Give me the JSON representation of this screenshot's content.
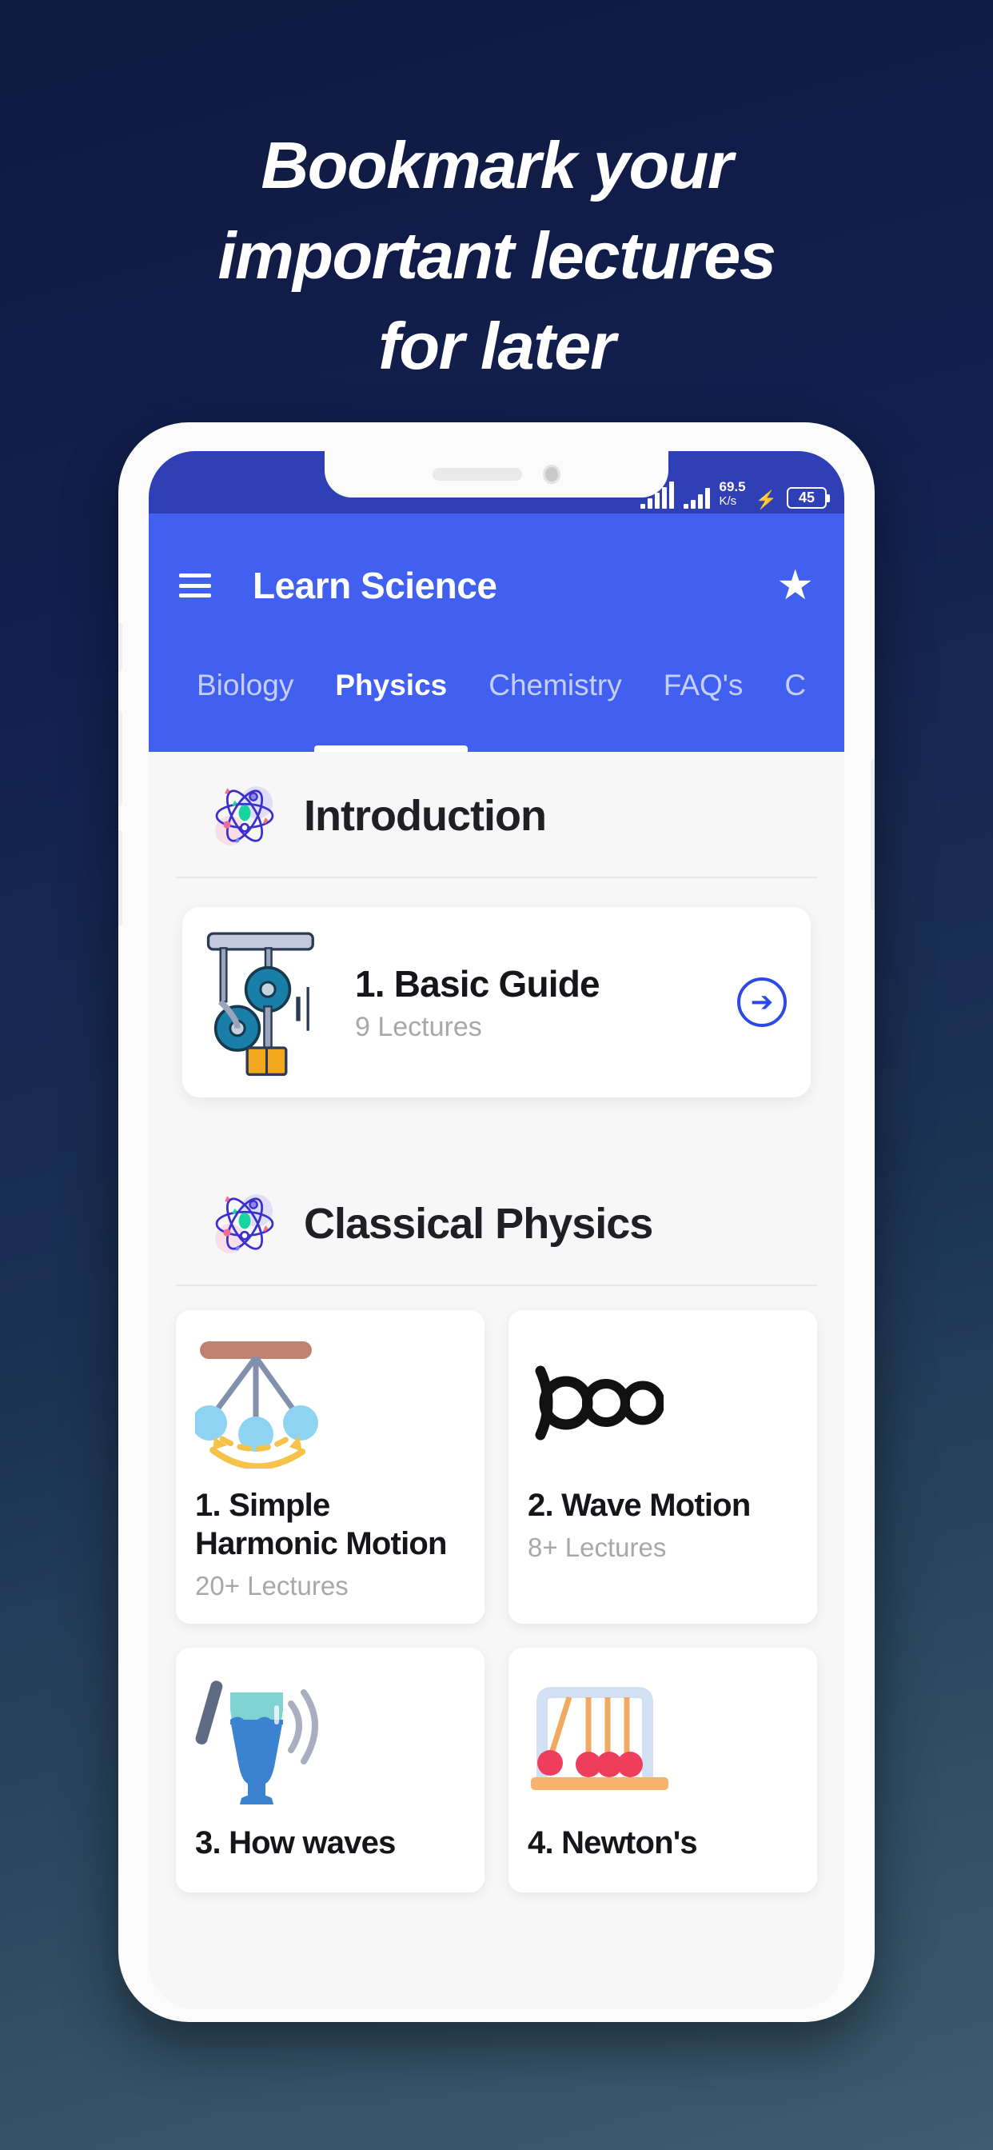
{
  "promo": {
    "headline_lines": [
      "Bookmark your",
      "important lectures",
      "for later"
    ],
    "bg_gradient_from": "#10193f",
    "bg_gradient_to": "#3d5c70"
  },
  "phone": {
    "statusbar": {
      "network_speed_value": "69.5",
      "network_speed_unit": "K/s",
      "charging_icon": "bolt-icon",
      "battery_level": "45",
      "signal_icon": "signal-bars-icon",
      "background": "#2f3fb5"
    },
    "notch": {
      "speaker_icon": "speaker-slot-icon",
      "camera_icon": "front-camera-icon"
    }
  },
  "appbar": {
    "menu_icon": "hamburger-menu-icon",
    "title": "Learn Science",
    "bookmark_icon": "star-icon",
    "accent": "#4160ef"
  },
  "tabs": {
    "items": [
      {
        "label": "Biology",
        "active": false
      },
      {
        "label": "Physics",
        "active": true
      },
      {
        "label": "Chemistry",
        "active": false
      },
      {
        "label": "FAQ's",
        "active": false
      },
      {
        "label": "C",
        "active": false
      }
    ]
  },
  "sections": [
    {
      "icon": "atom-icon",
      "title": "Introduction",
      "course": {
        "thumb_icon": "pulley-system-icon",
        "title": "1. Basic Guide",
        "subtitle": "9 Lectures",
        "action_icon": "arrow-right-circle-icon"
      }
    },
    {
      "icon": "atom-icon",
      "title": "Classical Physics",
      "tiles": [
        {
          "art": "pendulum-icon",
          "title": "1. Simple Harmonic Motion",
          "subtitle": "20+ Lectures"
        },
        {
          "art": "wave-loop-icon",
          "title": "2. Wave Motion",
          "subtitle": "8+ Lectures"
        },
        {
          "art": "resonance-glass-icon",
          "title": "3. How waves",
          "subtitle": ""
        },
        {
          "art": "newtons-cradle-icon",
          "title": "4. Newton's",
          "subtitle": ""
        }
      ]
    }
  ]
}
